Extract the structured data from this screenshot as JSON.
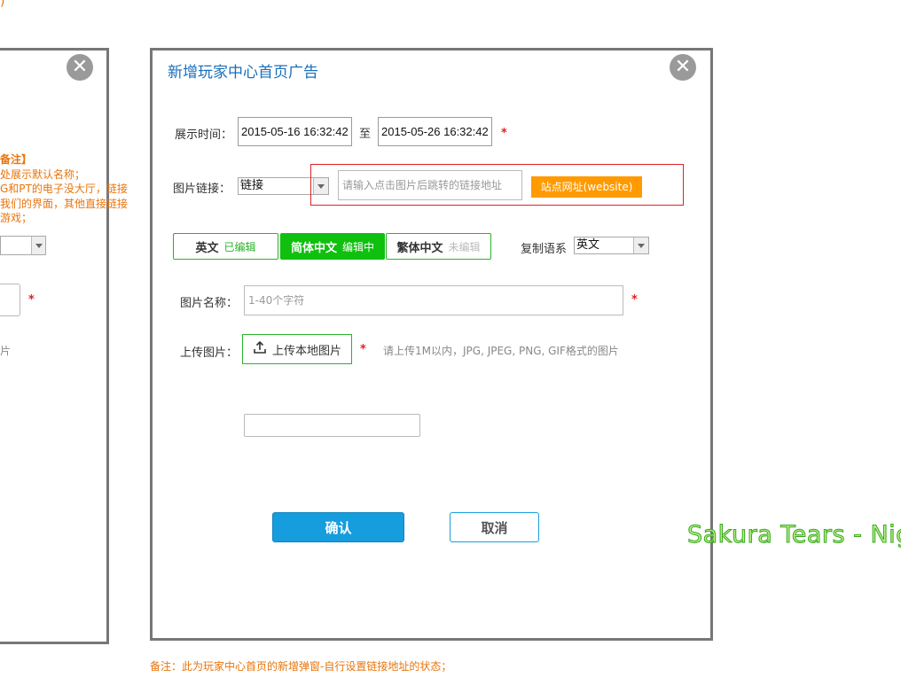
{
  "top_fragment": ")",
  "left_panel": {
    "note_lines": [
      "备注】",
      "处展示默认名称；",
      "G和PT的电子没大厅，链接",
      "我们的界面，其他直接链接",
      "游戏；"
    ],
    "required_mark": "*",
    "hint_fragment": "片"
  },
  "dialog": {
    "title": "新增玩家中心首页广告",
    "display_time": {
      "label": "展示时间：",
      "start": "2015-05-16 16:32:42",
      "separator": "至",
      "end": "2015-05-26 16:32:42",
      "required_mark": "*"
    },
    "image_link": {
      "label": "图片链接：",
      "type_selected": "链接",
      "url_placeholder": "请输入点击图片后跳转的链接地址",
      "site_button": "站点网址(website)"
    },
    "language_tabs": [
      {
        "name": "英文",
        "status": "已编辑",
        "status_color": "#28b428"
      },
      {
        "name": "简体中文",
        "status": "编辑中",
        "status_color": "#ffffff"
      },
      {
        "name": "繁体中文",
        "status": "未编辑",
        "status_color": "#bbbbbb"
      }
    ],
    "copy_language": {
      "label": "复制语系",
      "selected": "英文"
    },
    "image_name": {
      "label": "图片名称：",
      "placeholder": "1-40个字符",
      "required_mark": "*"
    },
    "upload": {
      "label": "上传图片：",
      "button": "上传本地图片",
      "required_mark": "*",
      "hint": "请上传1M以内，JPG, JPEG, PNG, GIF格式的图片"
    },
    "confirm_button": "确认",
    "cancel_button": "取消"
  },
  "watermark": "Sakura Tears - Nig",
  "bottom_note": "备注：此为玩家中心首页的新增弹窗-自行设置链接地址的状态；",
  "colors": {
    "accent_blue": "#159dde",
    "title_blue": "#1a6fba",
    "green": "#0fc00f",
    "orange": "#ff9a00",
    "note_orange": "#e8740c",
    "required_red": "#e02020"
  }
}
